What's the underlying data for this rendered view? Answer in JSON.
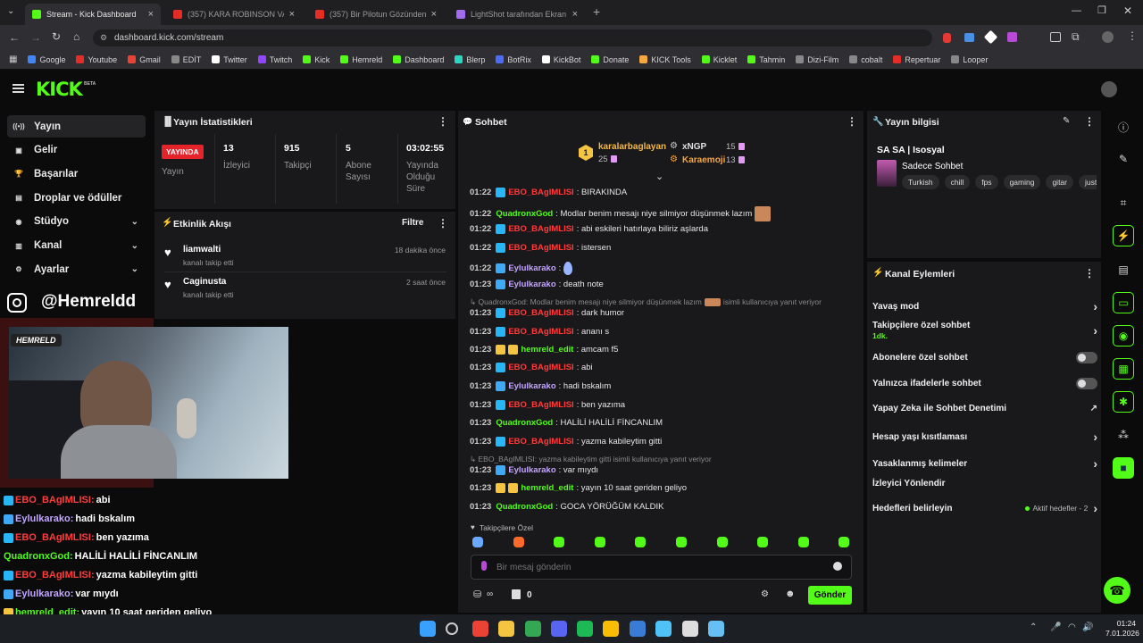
{
  "browser": {
    "tabs": [
      {
        "label": "Stream - Kick Dashboard",
        "active": true,
        "color": "#53fc18"
      },
      {
        "label": "(357) KARA ROBINSON VAKAS...",
        "active": false,
        "color": "#e52d27"
      },
      {
        "label": "(357) Bir Pilotun Gözünden - Y...",
        "active": false,
        "color": "#e52d27"
      },
      {
        "label": "LightShot tarafından Ekran Gö...",
        "active": false,
        "color": "#a36bf0"
      }
    ],
    "url": "dashboard.kick.com/stream",
    "bookmarks": [
      "Google",
      "Youtube",
      "Gmail",
      "EDİT",
      "Twitter",
      "Twitch",
      "Kick",
      "Hemreld",
      "Dashboard",
      "Blerp",
      "BotRix",
      "KickBot",
      "Donate",
      "KICK Tools",
      "Kicklet",
      "Tahmin",
      "Dizi-Film",
      "cobalt",
      "Repertuar",
      "Looper"
    ]
  },
  "header": {
    "logo": "KICK",
    "beta": "BETA"
  },
  "sidebar": {
    "items": [
      {
        "label": "Yayın",
        "icon": "broadcast-icon",
        "selected": true
      },
      {
        "label": "Gelir",
        "icon": "money-icon"
      },
      {
        "label": "Başarılar",
        "icon": "trophy-icon"
      },
      {
        "label": "Droplar ve ödüller",
        "icon": "gift-icon"
      },
      {
        "label": "Stüdyo",
        "icon": "studio-icon",
        "chevron": true
      },
      {
        "label": "Kanal",
        "icon": "chart-icon",
        "chevron": true
      },
      {
        "label": "Ayarlar",
        "icon": "gear-icon",
        "chevron": true
      }
    ]
  },
  "overlay": {
    "instagram": "@Hemreldd",
    "cam_tag": "HEMRELD"
  },
  "overlay_chat": [
    {
      "user": "EBO_BAgIMLISI:",
      "text": "abi",
      "color": "#ff3b3b",
      "badge": "#29b6f6"
    },
    {
      "user": "Eylulkarako:",
      "text": "hadi bskalım",
      "color": "#c3a6ff",
      "badge": "#3fa9f5"
    },
    {
      "user": "EBO_BAgIMLISI:",
      "text": "ben yazıma",
      "color": "#ff3b3b",
      "badge": "#29b6f6"
    },
    {
      "user": "QuadronxGod:",
      "text": "HALİLİ HALİLİ FİNCANLIM",
      "color": "#53fc18",
      "badge": ""
    },
    {
      "user": "EBO_BAgIMLISI:",
      "text": "yazma kabileytim gitti",
      "color": "#ff3b3b",
      "badge": "#29b6f6"
    },
    {
      "user": "Eylulkarako:",
      "text": "var mıydı",
      "color": "#c3a6ff",
      "badge": "#3fa9f5"
    },
    {
      "user": "hemreld_edit:",
      "text": "yayın 10 saat geriden geliyo",
      "color": "#53fc18",
      "badge": "#f5c542"
    },
    {
      "user": "QuadronxGod:",
      "text": "GOCA YÖRÜĞÜM KALDIK",
      "color": "#53fc18",
      "badge": ""
    }
  ],
  "stats": {
    "title": "Yayın İstatistikleri",
    "live_badge": "YAYINDA",
    "live_label": "Yayın",
    "viewers": "13",
    "viewers_label": "İzleyici",
    "followers": "915",
    "followers_label": "Takipçi",
    "subs": "5",
    "subs_label": "Abone Sayısı",
    "uptime": "03:02:55",
    "uptime_label": "Yayında Olduğu Süre"
  },
  "activity": {
    "title": "Etkinlik Akışı",
    "filter": "Filtre",
    "events": [
      {
        "user": "liamwalti",
        "action": "kanalı takip etti",
        "time": "18 dakika önce"
      },
      {
        "user": "Caginusta",
        "action": "kanalı takip etti",
        "time": "2 saat önce"
      }
    ]
  },
  "chat": {
    "title": "Sohbet",
    "leaders": [
      {
        "rank": "1",
        "name": "karalarbaglayan",
        "count": "25"
      },
      {
        "rank": "",
        "name": "xNGP",
        "count": "15"
      },
      {
        "rank": "",
        "name": "Karaemoji",
        "count": "13"
      }
    ],
    "messages": [
      {
        "time": "01:22",
        "user": "EBO_BAgIMLISI",
        "text": ": BIRAKINDA",
        "color": "#ff3b3b",
        "badge": "#29b6f6"
      },
      {
        "time": "01:22",
        "user": "QuadronxGod",
        "text": ": Modlar benim mesajı niye silmiyor düşünmek lazım",
        "color": "#53fc18",
        "badge": ""
      },
      {
        "time": "01:22",
        "user": "EBO_BAgIMLISI",
        "text": ": abi eskileri hatırlaya biliriz aşlarda",
        "color": "#ff3b3b",
        "badge": "#29b6f6"
      },
      {
        "time": "01:22",
        "user": "EBO_BAgIMLISI",
        "text": ": istersen",
        "color": "#ff3b3b",
        "badge": "#29b6f6"
      },
      {
        "time": "01:22",
        "user": "Eylulkarako",
        "text": ":",
        "color": "#c3a6ff",
        "badge": "#3fa9f5"
      },
      {
        "time": "01:23",
        "user": "Eylulkarako",
        "text": ": death note",
        "color": "#c3a6ff",
        "badge": "#3fa9f5"
      },
      {
        "reply": "QuadronxGod: Modlar benim mesajı niye silmiyor düşünmek lazım",
        "reply_suffix": "isimli kullanıcıya yanıt veriyor"
      },
      {
        "time": "01:23",
        "user": "EBO_BAgIMLISI",
        "text": ": dark humor",
        "color": "#ff3b3b",
        "badge": "#29b6f6"
      },
      {
        "time": "01:23",
        "user": "EBO_BAgIMLISI",
        "text": ": ananı s",
        "color": "#ff3b3b",
        "badge": "#29b6f6"
      },
      {
        "time": "01:23",
        "user": "hemreld_edit",
        "text": ": amcam f5",
        "color": "#53fc18",
        "badge": "#f5c542"
      },
      {
        "time": "01:23",
        "user": "EBO_BAgIMLISI",
        "text": ": abi",
        "color": "#ff3b3b",
        "badge": "#29b6f6"
      },
      {
        "time": "01:23",
        "user": "Eylulkarako",
        "text": ": hadi bskalım",
        "color": "#c3a6ff",
        "badge": "#3fa9f5"
      },
      {
        "time": "01:23",
        "user": "EBO_BAgIMLISI",
        "text": ": ben yazıma",
        "color": "#ff3b3b",
        "badge": "#29b6f6"
      },
      {
        "time": "01:23",
        "user": "QuadronxGod",
        "text": ": HALİLİ HALİLİ FİNCANLIM",
        "color": "#53fc18",
        "badge": ""
      },
      {
        "time": "01:23",
        "user": "EBO_BAgIMLISI",
        "text": ": yazma kabileytim gitti",
        "color": "#ff3b3b",
        "badge": "#29b6f6"
      },
      {
        "reply": "EBO_BAgIMLISI: yazma kabileytim gitti isimli kullanıcıya yanıt veriyor",
        "reply_suffix": ""
      },
      {
        "time": "01:23",
        "user": "Eylulkarako",
        "text": ": var mıydı",
        "color": "#c3a6ff",
        "badge": "#3fa9f5"
      },
      {
        "time": "01:23",
        "user": "hemreld_edit",
        "text": ": yayın 10 saat geriden geliyo",
        "color": "#53fc18",
        "badge": "#f5c542"
      },
      {
        "time": "01:23",
        "user": "QuadronxGod",
        "text": ": GOCA YÖRÜĞÜM KALDIK",
        "color": "#53fc18",
        "badge": ""
      }
    ],
    "followers_only": "Takipçilere Özel",
    "placeholder": "Bir mesaj gönderin",
    "points": "0",
    "send": "Gönder"
  },
  "info": {
    "title": "Yayın bilgisi",
    "stream_title": "SA SA | Isosyal",
    "category": "Sadece Sohbet",
    "tags": [
      "Turkish",
      "chill",
      "fps",
      "gaming",
      "gitar",
      "justcha"
    ]
  },
  "actions": {
    "title": "Kanal Eylemleri",
    "items": [
      {
        "label": "Yavaş mod",
        "type": "arrow"
      },
      {
        "label": "Takipçilere özel sohbet",
        "sub": "1dk.",
        "type": "arrow"
      },
      {
        "label": "Abonelere özel sohbet",
        "type": "toggle"
      },
      {
        "label": "Yalnızca ifadelerle sohbet",
        "type": "toggle"
      },
      {
        "label": "Yapay Zeka ile Sohbet Denetimi",
        "type": "external"
      },
      {
        "label": "Hesap yaşı kısıtlaması",
        "type": "arrow"
      },
      {
        "label": "Yasaklanmış kelimeler",
        "type": "arrow"
      },
      {
        "label": "İzleyici Yönlendir",
        "type": "none"
      },
      {
        "label": "Hedefleri belirleyin",
        "sub": "Aktif hedefler - 2",
        "type": "arrow"
      }
    ]
  },
  "clock": {
    "time": "01:24",
    "date": "7.01.2026"
  }
}
